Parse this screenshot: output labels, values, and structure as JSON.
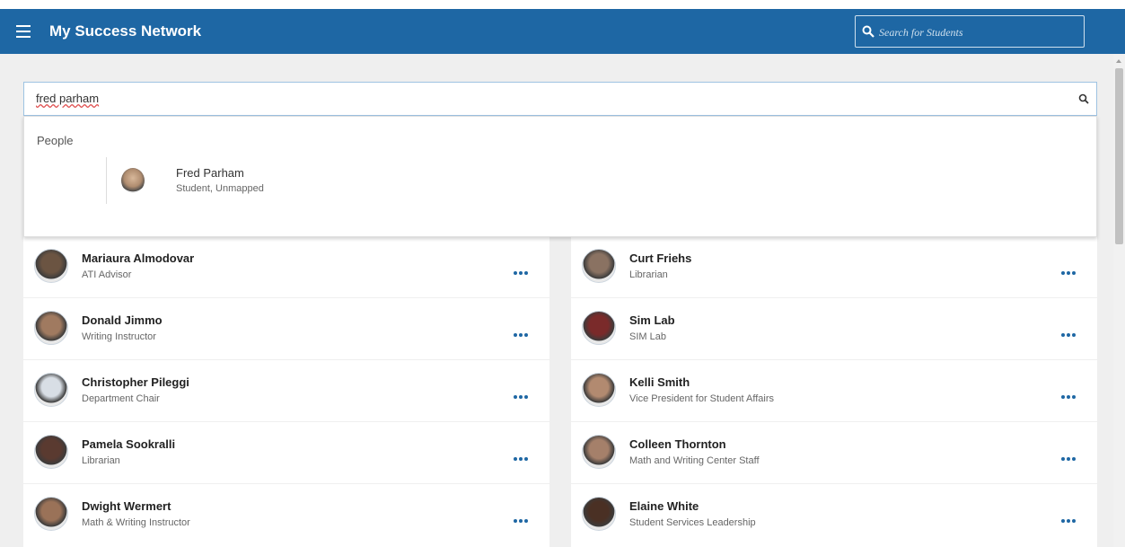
{
  "header": {
    "title": "My Success Network",
    "menu_icon": "hamburger-icon",
    "search_placeholder": "Search for Students",
    "bg_color": "#1e67a4"
  },
  "search": {
    "value": "fred parham",
    "icon": "search-icon"
  },
  "dropdown": {
    "section_label": "People",
    "results": [
      {
        "name": "Fred Parham",
        "role": "Student, Unmapped"
      }
    ]
  },
  "contacts": [
    {
      "name": "Mariaura Almodovar",
      "role": "ATI Advisor",
      "avatar_color": "#6b5442"
    },
    {
      "name": "Curt Friehs",
      "role": "Librarian",
      "avatar_color": "#8a7262"
    },
    {
      "name": "Donald Jimmo",
      "role": "Writing Instructor",
      "avatar_color": "#a07a60"
    },
    {
      "name": "Sim Lab",
      "role": "SIM Lab",
      "avatar_color": "#7a2a2a"
    },
    {
      "name": "Christopher Pileggi",
      "role": "Department Chair",
      "avatar_color": "#d8dee5"
    },
    {
      "name": "Kelli Smith",
      "role": "Vice President for Student Affairs",
      "avatar_color": "#b28a70"
    },
    {
      "name": "Pamela Sookralli",
      "role": "Librarian",
      "avatar_color": "#5a3a30"
    },
    {
      "name": "Colleen Thornton",
      "role": "Math and Writing Center Staff",
      "avatar_color": "#a5806a"
    },
    {
      "name": "Dwight Wermert",
      "role": "Math & Writing Instructor",
      "avatar_color": "#9a7258"
    },
    {
      "name": "Elaine White",
      "role": "Student Services Leadership",
      "avatar_color": "#4a3024"
    }
  ]
}
